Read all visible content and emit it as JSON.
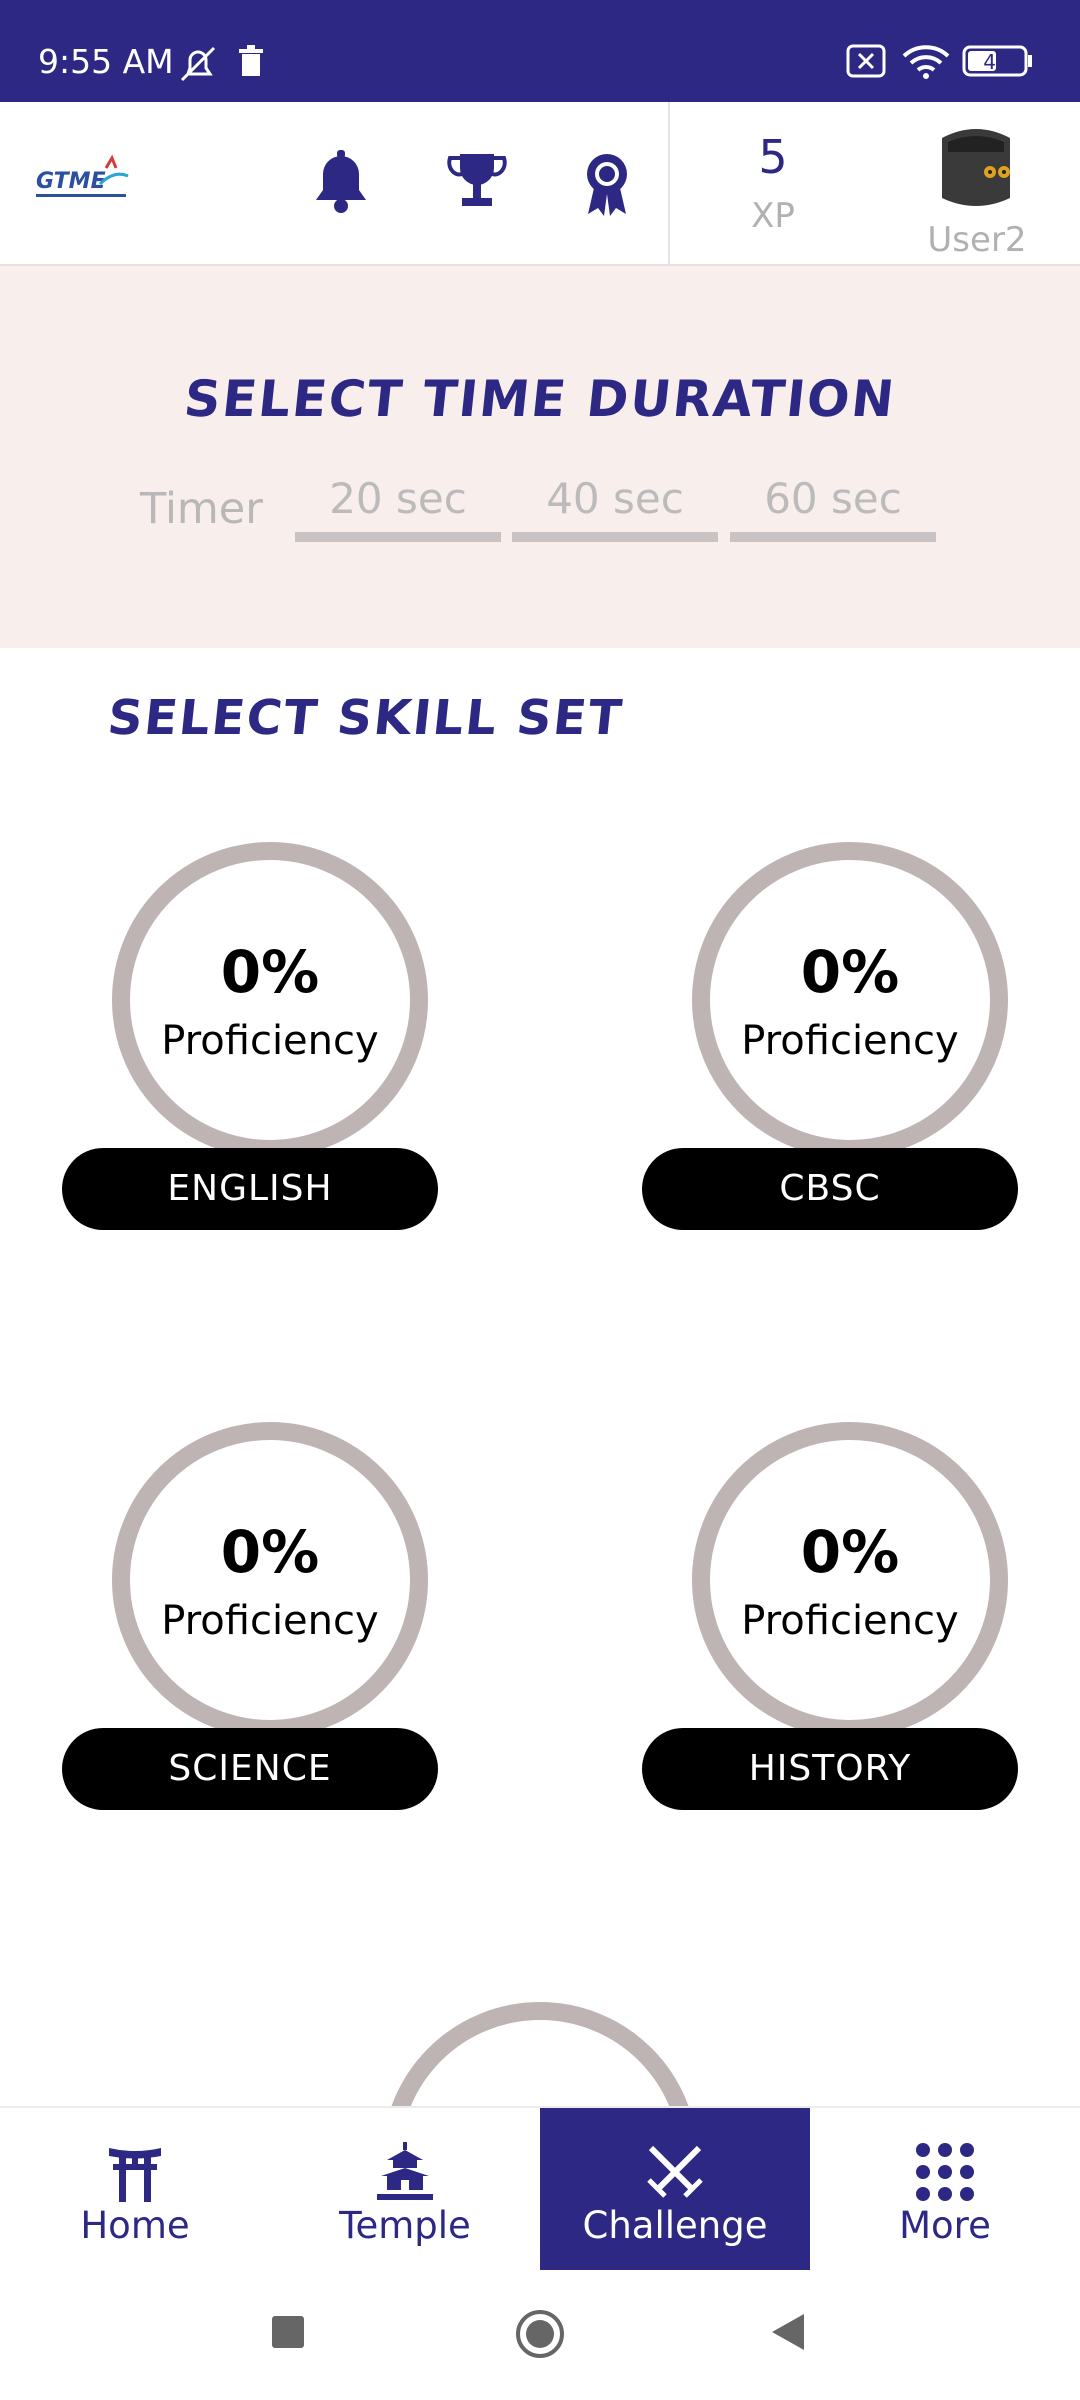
{
  "status_bar": {
    "time": "9:55 AM",
    "battery": "47"
  },
  "header": {
    "logo_text": "GTME",
    "xp_value": "5",
    "xp_label": "XP",
    "username": "User2"
  },
  "timer": {
    "title": "SELECT TIME DURATION",
    "label": "Timer",
    "options": [
      "20 sec",
      "40 sec",
      "60 sec"
    ]
  },
  "skills": {
    "title": "SELECT SKILL SET",
    "items": [
      {
        "name": "ENGLISH",
        "percent": "0%",
        "caption": "Proficiency"
      },
      {
        "name": "CBSC",
        "percent": "0%",
        "caption": "Proficiency"
      },
      {
        "name": "SCIENCE",
        "percent": "0%",
        "caption": "Proficiency"
      },
      {
        "name": "HISTORY",
        "percent": "0%",
        "caption": "Proficiency"
      }
    ]
  },
  "bottom_nav": {
    "items": [
      {
        "label": "Home",
        "icon": "torii-gate-icon"
      },
      {
        "label": "Temple",
        "icon": "temple-icon"
      },
      {
        "label": "Challenge",
        "icon": "crossed-swords-icon",
        "active": true
      },
      {
        "label": "More",
        "icon": "grid-dots-icon"
      }
    ]
  },
  "colors": {
    "primary": "#2c2883",
    "ring": "#bfb4b4",
    "timer_bg": "#f8eeec"
  }
}
